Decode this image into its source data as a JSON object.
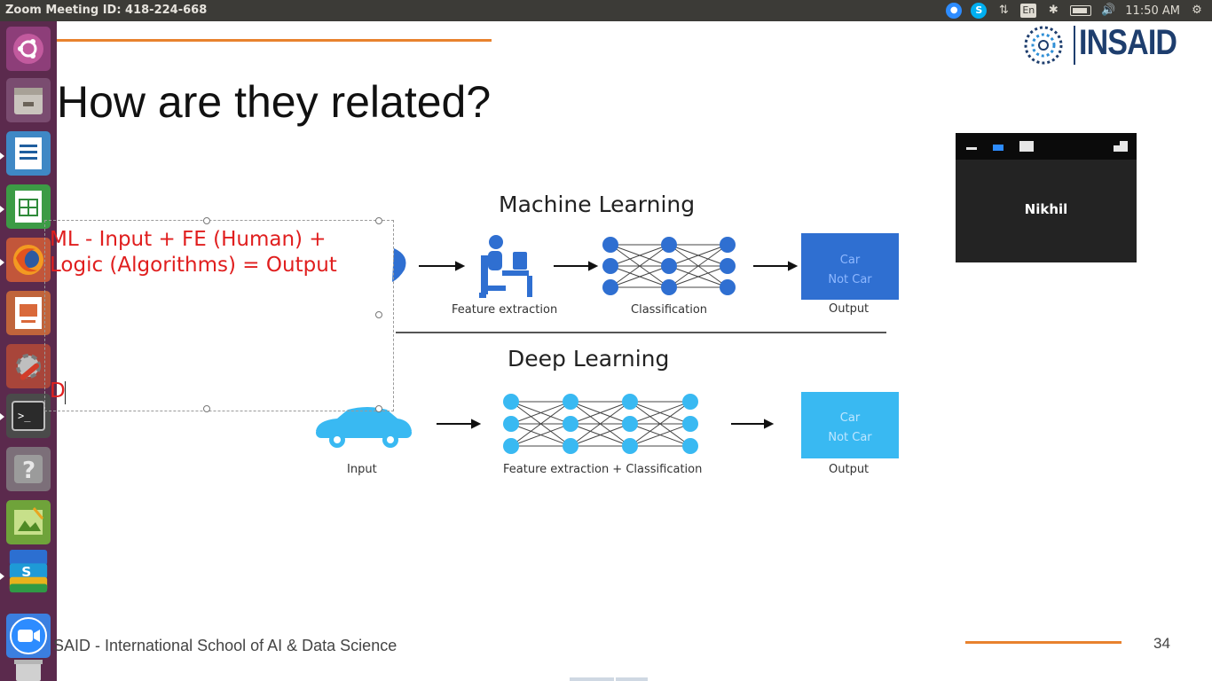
{
  "topbar": {
    "title": "Zoom Meeting ID: 418-224-668",
    "tray": {
      "zoom_icon": "zoom-icon",
      "skype_icon": "skype-icon",
      "network_icon": "network-arrows-icon",
      "keyboard_layout": "En",
      "bluetooth_icon": "bluetooth-icon",
      "battery_icon": "battery-icon",
      "volume_icon": "volume-icon",
      "clock": "11:50 AM",
      "settings_icon": "gear-icon"
    }
  },
  "launcher": {
    "items": [
      {
        "name": "ubuntu-dash",
        "icon": "ubuntu-logo-icon"
      },
      {
        "name": "files",
        "icon": "file-cabinet-icon"
      },
      {
        "name": "libreoffice-writer",
        "icon": "writer-document-icon"
      },
      {
        "name": "libreoffice-calc",
        "icon": "calc-spreadsheet-icon"
      },
      {
        "name": "firefox",
        "icon": "firefox-icon"
      },
      {
        "name": "libreoffice-impress",
        "icon": "impress-presentation-icon"
      },
      {
        "name": "system-settings",
        "icon": "settings-wrench-icon"
      },
      {
        "name": "terminal",
        "icon": "terminal-icon"
      },
      {
        "name": "help",
        "icon": "help-question-icon"
      },
      {
        "name": "gedit-image",
        "icon": "image-viewer-icon"
      },
      {
        "name": "stacked-apps",
        "icon": "stacked-apps-icon"
      },
      {
        "name": "zoom",
        "icon": "zoom-video-icon"
      },
      {
        "name": "trash",
        "icon": "trash-icon"
      }
    ],
    "terminal_prompt": ">_",
    "help_glyph": "?"
  },
  "slide": {
    "title": "How are they related?",
    "logo_text": "INSAID",
    "footer": "SAID - International School of AI & Data Science",
    "page_number": "34",
    "textbox": {
      "line1": "ML - Input + FE (Human) +",
      "line2": "Logic (Algorithms) = Output",
      "line3": "D"
    },
    "diagram": {
      "ml_title": "Machine Learning",
      "dl_title": "Deep Learning",
      "ml_feature_label": "Feature extraction",
      "ml_class_label": "Classification",
      "ml_output_label": "Output",
      "ml_output_line1": "Car",
      "ml_output_line2": "Not Car",
      "dl_input_label": "Input",
      "dl_fe_label": "Feature extraction + Classification",
      "dl_output_label": "Output",
      "dl_output_line1": "Car",
      "dl_output_line2": "Not Car",
      "ml_color": "#2f6fd1",
      "dl_color": "#39b9f2"
    }
  },
  "video": {
    "participant": "Nikhil"
  }
}
